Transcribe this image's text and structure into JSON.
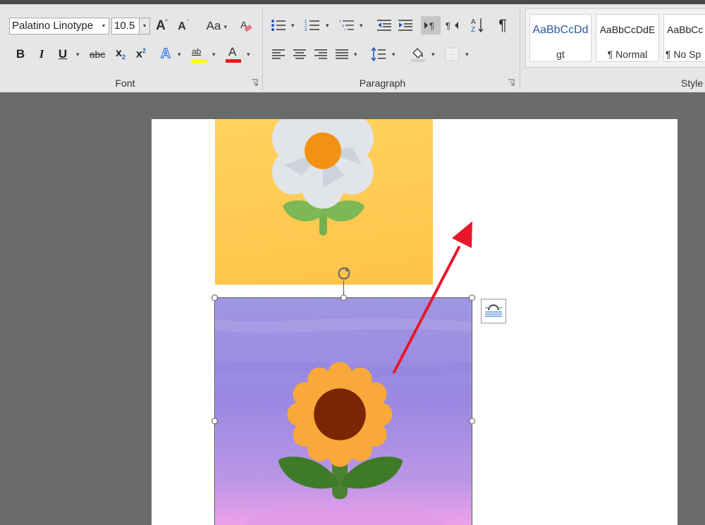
{
  "ribbon": {
    "font_group": {
      "label": "Font",
      "font_name": "Palatino Linotype",
      "font_size": "10.5",
      "change_case_label": "Aa",
      "buttons": [
        "Grow Font",
        "Shrink Font",
        "Change Case",
        "Clear Formatting",
        "Bold",
        "Italic",
        "Underline",
        "Strikethrough",
        "Subscript",
        "Superscript",
        "Text Effects",
        "Text Highlight Color",
        "Font Color"
      ],
      "labels": {
        "bold": "B",
        "italic": "I",
        "underline": "U",
        "strike": "abc",
        "subscript": "x",
        "sub_digit": "2",
        "superscript": "x",
        "super_digit": "2",
        "grow": "A",
        "shrink": "A",
        "effects": "A",
        "highlight": "ab",
        "fontcolor": "A"
      },
      "highlight_color": "#ffff00",
      "font_color": "#e01b1b"
    },
    "paragraph_group": {
      "label": "Paragraph",
      "pilcrow": "¶"
    },
    "styles_group": {
      "label": "Style",
      "cards": [
        {
          "sample": "AaBbCcDd",
          "name": "gt"
        },
        {
          "sample": "AaBbCcDdE",
          "name": "¶ Normal"
        },
        {
          "sample": "AaBbCc",
          "name": "¶ No Sp"
        }
      ]
    }
  },
  "document": {
    "images": [
      {
        "name": "white flower on yellow background",
        "selected": false
      },
      {
        "name": "sunflower on purple background",
        "selected": true
      }
    ],
    "layout_options_icon": "layout-options-icon",
    "rotate_handle_icon": "rotate-icon",
    "annotation": {
      "type": "red arrow",
      "color": "#e8172a"
    }
  }
}
